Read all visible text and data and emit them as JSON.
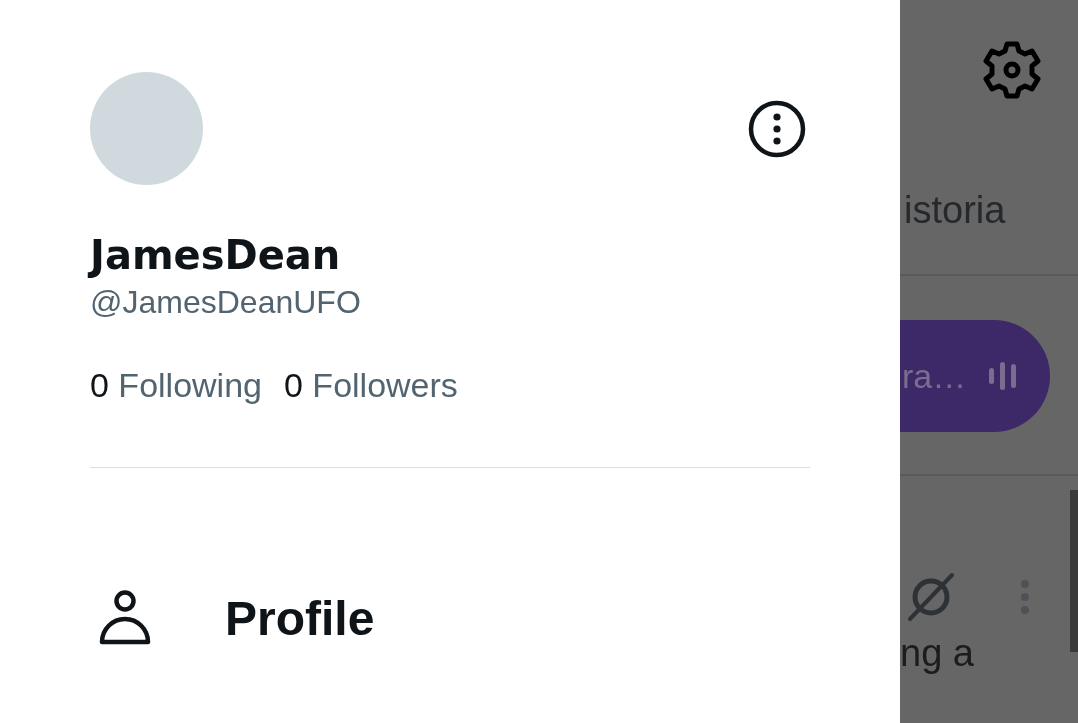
{
  "drawer": {
    "name": "JamesDean",
    "handle": "@JamesDeanUFO",
    "stats": [
      {
        "count": "0",
        "label": "Following"
      },
      {
        "count": "0",
        "label": "Followers"
      }
    ],
    "menu": [
      {
        "label": "Profile"
      }
    ]
  },
  "background": {
    "tab_label": "istoria",
    "pill_text": "ra…",
    "post_text": "ng a"
  }
}
